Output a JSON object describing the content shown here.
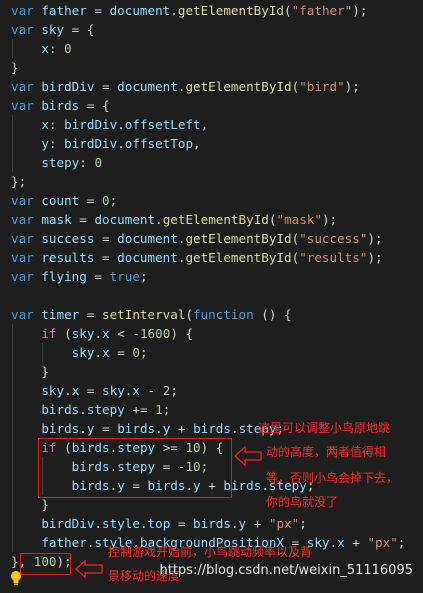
{
  "code": [
    [
      [
        "kw",
        "var"
      ],
      [
        "punc",
        " "
      ],
      [
        "var",
        "father"
      ],
      [
        "op",
        " = "
      ],
      [
        "var",
        "document"
      ],
      [
        "punc",
        "."
      ],
      [
        "fn",
        "getElementById"
      ],
      [
        "punc",
        "("
      ],
      [
        "str",
        "\"father\""
      ],
      [
        "punc",
        ");"
      ]
    ],
    [
      [
        "kw",
        "var"
      ],
      [
        "punc",
        " "
      ],
      [
        "var",
        "sky"
      ],
      [
        "op",
        " = {"
      ]
    ],
    [
      [
        "punc",
        "    "
      ],
      [
        "var",
        "x"
      ],
      [
        "punc",
        ": "
      ],
      [
        "num",
        "0"
      ]
    ],
    [
      [
        "punc",
        "}"
      ]
    ],
    [
      [
        "kw",
        "var"
      ],
      [
        "punc",
        " "
      ],
      [
        "var",
        "birdDiv"
      ],
      [
        "op",
        " = "
      ],
      [
        "var",
        "document"
      ],
      [
        "punc",
        "."
      ],
      [
        "fn",
        "getElementById"
      ],
      [
        "punc",
        "("
      ],
      [
        "str",
        "\"bird\""
      ],
      [
        "punc",
        ");"
      ]
    ],
    [
      [
        "kw",
        "var"
      ],
      [
        "punc",
        " "
      ],
      [
        "var",
        "birds"
      ],
      [
        "op",
        " = {"
      ]
    ],
    [
      [
        "punc",
        "    "
      ],
      [
        "var",
        "x"
      ],
      [
        "punc",
        ": "
      ],
      [
        "var",
        "birdDiv"
      ],
      [
        "punc",
        "."
      ],
      [
        "var",
        "offsetLeft"
      ],
      [
        "punc",
        ","
      ]
    ],
    [
      [
        "punc",
        "    "
      ],
      [
        "var",
        "y"
      ],
      [
        "punc",
        ": "
      ],
      [
        "var",
        "birdDiv"
      ],
      [
        "punc",
        "."
      ],
      [
        "var",
        "offsetTop"
      ],
      [
        "punc",
        ","
      ]
    ],
    [
      [
        "punc",
        "    "
      ],
      [
        "var",
        "stepy"
      ],
      [
        "punc",
        ": "
      ],
      [
        "num",
        "0"
      ]
    ],
    [
      [
        "punc",
        "};"
      ]
    ],
    [
      [
        "kw",
        "var"
      ],
      [
        "punc",
        " "
      ],
      [
        "var",
        "count"
      ],
      [
        "op",
        " = "
      ],
      [
        "num",
        "0"
      ],
      [
        "punc",
        ";"
      ]
    ],
    [
      [
        "kw",
        "var"
      ],
      [
        "punc",
        " "
      ],
      [
        "var",
        "mask"
      ],
      [
        "op",
        " = "
      ],
      [
        "var",
        "document"
      ],
      [
        "punc",
        "."
      ],
      [
        "fn",
        "getElementById"
      ],
      [
        "punc",
        "("
      ],
      [
        "str",
        "\"mask\""
      ],
      [
        "punc",
        ");"
      ]
    ],
    [
      [
        "kw",
        "var"
      ],
      [
        "punc",
        " "
      ],
      [
        "var",
        "success"
      ],
      [
        "op",
        " = "
      ],
      [
        "var",
        "document"
      ],
      [
        "punc",
        "."
      ],
      [
        "fn",
        "getElementById"
      ],
      [
        "punc",
        "("
      ],
      [
        "str",
        "\"success\""
      ],
      [
        "punc",
        ");"
      ]
    ],
    [
      [
        "kw",
        "var"
      ],
      [
        "punc",
        " "
      ],
      [
        "var",
        "results"
      ],
      [
        "op",
        " = "
      ],
      [
        "var",
        "document"
      ],
      [
        "punc",
        "."
      ],
      [
        "fn",
        "getElementById"
      ],
      [
        "punc",
        "("
      ],
      [
        "str",
        "\"results\""
      ],
      [
        "punc",
        ");"
      ]
    ],
    [
      [
        "kw",
        "var"
      ],
      [
        "punc",
        " "
      ],
      [
        "var",
        "flying"
      ],
      [
        "op",
        " = "
      ],
      [
        "kw",
        "true"
      ],
      [
        "punc",
        ";"
      ]
    ],
    [],
    [
      [
        "kw",
        "var"
      ],
      [
        "punc",
        " "
      ],
      [
        "var",
        "timer"
      ],
      [
        "op",
        " = "
      ],
      [
        "fn",
        "setInterval"
      ],
      [
        "punc",
        "("
      ],
      [
        "kw",
        "function"
      ],
      [
        "punc",
        " () {"
      ]
    ],
    [
      [
        "punc",
        "    "
      ],
      [
        "ctl",
        "if"
      ],
      [
        "punc",
        " ("
      ],
      [
        "var",
        "sky"
      ],
      [
        "punc",
        "."
      ],
      [
        "var",
        "x"
      ],
      [
        "op",
        " < -"
      ],
      [
        "num",
        "1600"
      ],
      [
        "punc",
        ") {"
      ]
    ],
    [
      [
        "punc",
        "        "
      ],
      [
        "var",
        "sky"
      ],
      [
        "punc",
        "."
      ],
      [
        "var",
        "x"
      ],
      [
        "op",
        " = "
      ],
      [
        "num",
        "0"
      ],
      [
        "punc",
        ";"
      ]
    ],
    [
      [
        "punc",
        "    }"
      ]
    ],
    [
      [
        "punc",
        "    "
      ],
      [
        "var",
        "sky"
      ],
      [
        "punc",
        "."
      ],
      [
        "var",
        "x"
      ],
      [
        "op",
        " = "
      ],
      [
        "var",
        "sky"
      ],
      [
        "punc",
        "."
      ],
      [
        "var",
        "x"
      ],
      [
        "op",
        " - "
      ],
      [
        "num",
        "2"
      ],
      [
        "punc",
        ";"
      ]
    ],
    [
      [
        "punc",
        "    "
      ],
      [
        "var",
        "birds"
      ],
      [
        "punc",
        "."
      ],
      [
        "var",
        "stepy"
      ],
      [
        "op",
        " += "
      ],
      [
        "num",
        "1"
      ],
      [
        "punc",
        ";"
      ]
    ],
    [
      [
        "punc",
        "    "
      ],
      [
        "var",
        "birds"
      ],
      [
        "punc",
        "."
      ],
      [
        "var",
        "y"
      ],
      [
        "op",
        " = "
      ],
      [
        "var",
        "birds"
      ],
      [
        "punc",
        "."
      ],
      [
        "var",
        "y"
      ],
      [
        "op",
        " + "
      ],
      [
        "var",
        "birds"
      ],
      [
        "punc",
        "."
      ],
      [
        "var",
        "stepy"
      ],
      [
        "punc",
        ";"
      ]
    ],
    [
      [
        "punc",
        "    "
      ],
      [
        "ctl",
        "if"
      ],
      [
        "punc",
        " ("
      ],
      [
        "var",
        "birds"
      ],
      [
        "punc",
        "."
      ],
      [
        "var",
        "stepy"
      ],
      [
        "op",
        " >= "
      ],
      [
        "num",
        "10"
      ],
      [
        "punc",
        ") {"
      ]
    ],
    [
      [
        "punc",
        "        "
      ],
      [
        "var",
        "birds"
      ],
      [
        "punc",
        "."
      ],
      [
        "var",
        "stepy"
      ],
      [
        "op",
        " = -"
      ],
      [
        "num",
        "10"
      ],
      [
        "punc",
        ";"
      ]
    ],
    [
      [
        "punc",
        "        "
      ],
      [
        "var",
        "birds"
      ],
      [
        "punc",
        "."
      ],
      [
        "var",
        "y"
      ],
      [
        "op",
        " = "
      ],
      [
        "var",
        "birds"
      ],
      [
        "punc",
        "."
      ],
      [
        "var",
        "y"
      ],
      [
        "op",
        " + "
      ],
      [
        "var",
        "birds"
      ],
      [
        "punc",
        "."
      ],
      [
        "var",
        "stepy"
      ],
      [
        "punc",
        ";"
      ]
    ],
    [
      [
        "punc",
        "    }"
      ]
    ],
    [
      [
        "punc",
        "    "
      ],
      [
        "var",
        "birdDiv"
      ],
      [
        "punc",
        "."
      ],
      [
        "var",
        "style"
      ],
      [
        "punc",
        "."
      ],
      [
        "var",
        "top"
      ],
      [
        "op",
        " = "
      ],
      [
        "var",
        "birds"
      ],
      [
        "punc",
        "."
      ],
      [
        "var",
        "y"
      ],
      [
        "op",
        " + "
      ],
      [
        "str",
        "\"px\""
      ],
      [
        "punc",
        ";"
      ]
    ],
    [
      [
        "punc",
        "    "
      ],
      [
        "var",
        "father"
      ],
      [
        "punc",
        "."
      ],
      [
        "var",
        "style"
      ],
      [
        "punc",
        "."
      ],
      [
        "var",
        "backgroundPositionX"
      ],
      [
        "op",
        " = "
      ],
      [
        "var",
        "sky"
      ],
      [
        "punc",
        "."
      ],
      [
        "var",
        "x"
      ],
      [
        "op",
        " + "
      ],
      [
        "str",
        "\"px\""
      ],
      [
        "punc",
        ";"
      ]
    ],
    [
      [
        "punc",
        "}, "
      ],
      [
        "num",
        "100"
      ],
      [
        "punc",
        ");"
      ]
    ]
  ],
  "annotations": {
    "note_stepy": [
      "这里可以调整小鸟原地跳",
      "动的高度，两者值得相",
      "等，否则小鸟会掉下去，",
      "你的鸟就没了"
    ],
    "note_interval": [
      "控制游戏开始前，小鸟跳动频率以及背",
      "景移动的速度"
    ]
  },
  "watermark": "https://blog.csdn.net/weixin_51116095",
  "colors": {
    "background": "#1e1e1e",
    "keyword": "#569cd6",
    "control": "#c586c0",
    "variable": "#9cdcfe",
    "function": "#dcdcaa",
    "string": "#ce9178",
    "number": "#b5cea8",
    "annotation": "#ff2b2b"
  },
  "icons": {
    "lightbulb": "lightbulb-icon",
    "arrow": "left-arrow-icon"
  }
}
